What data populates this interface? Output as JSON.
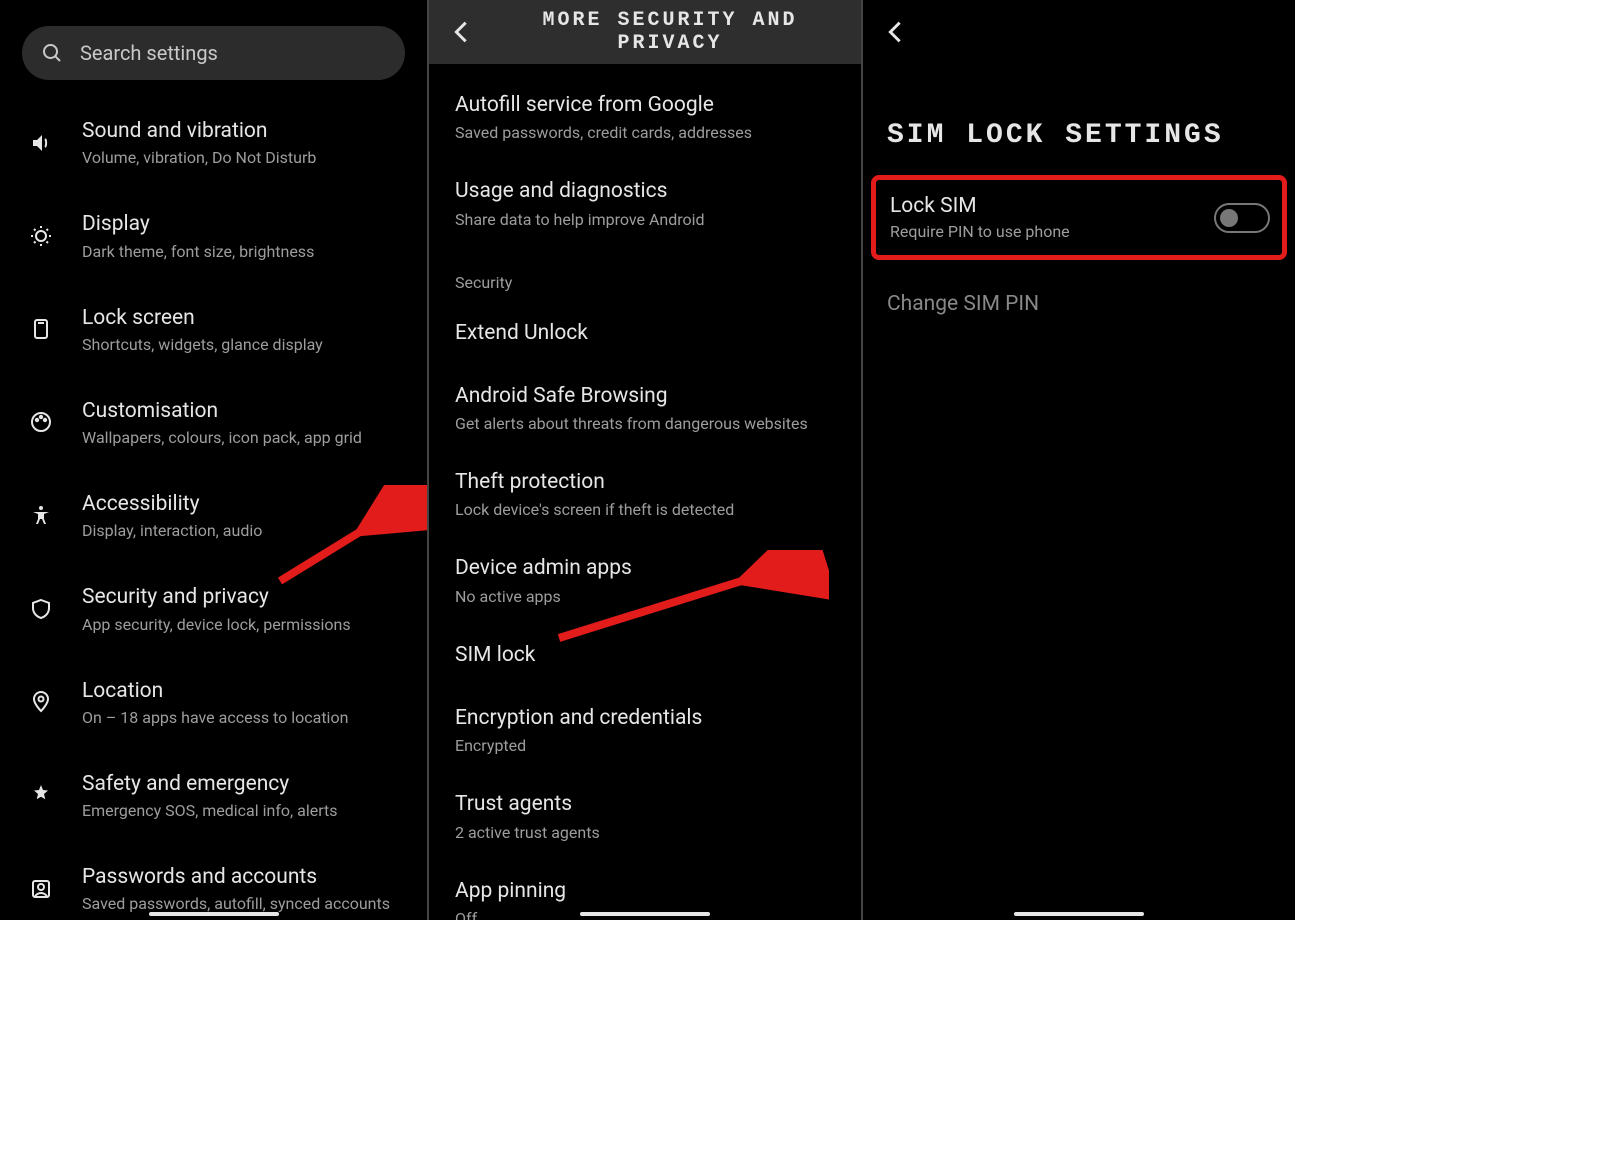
{
  "pane1": {
    "searchPlaceholder": "Search settings",
    "items": [
      {
        "title": "Sound and vibration",
        "sub": "Volume, vibration, Do Not Disturb"
      },
      {
        "title": "Display",
        "sub": "Dark theme, font size, brightness"
      },
      {
        "title": "Lock screen",
        "sub": "Shortcuts, widgets, glance display"
      },
      {
        "title": "Customisation",
        "sub": "Wallpapers, colours, icon pack, app grid"
      },
      {
        "title": "Accessibility",
        "sub": "Display, interaction, audio"
      },
      {
        "title": "Security and privacy",
        "sub": "App security, device lock, permissions"
      },
      {
        "title": "Location",
        "sub": "On – 18 apps have access to location"
      },
      {
        "title": "Safety and emergency",
        "sub": "Emergency SOS, medical info, alerts"
      },
      {
        "title": "Passwords and accounts",
        "sub": "Saved passwords, autofill, synced accounts"
      }
    ]
  },
  "pane2": {
    "header": "MORE SECURITY AND PRIVACY",
    "topItems": [
      {
        "title": "Autofill service from Google",
        "sub": "Saved passwords, credit cards, addresses"
      },
      {
        "title": "Usage and diagnostics",
        "sub": "Share data to help improve Android"
      }
    ],
    "sectionLabel": "Security",
    "securityItems": [
      {
        "title": "Extend Unlock",
        "sub": ""
      },
      {
        "title": "Android Safe Browsing",
        "sub": "Get alerts about threats from dangerous websites"
      },
      {
        "title": "Theft protection",
        "sub": "Lock device's screen if theft is detected"
      },
      {
        "title": "Device admin apps",
        "sub": "No active apps"
      },
      {
        "title": "SIM lock",
        "sub": ""
      },
      {
        "title": "Encryption and credentials",
        "sub": "Encrypted"
      },
      {
        "title": "Trust agents",
        "sub": "2 active trust agents"
      },
      {
        "title": "App pinning",
        "sub": "Off"
      }
    ]
  },
  "pane3": {
    "header": "SIM LOCK SETTINGS",
    "lockSim": {
      "title": "Lock SIM",
      "sub": "Require PIN to use phone",
      "enabled": false
    },
    "changePin": "Change SIM PIN"
  },
  "colors": {
    "highlight": "#e21b1b"
  }
}
